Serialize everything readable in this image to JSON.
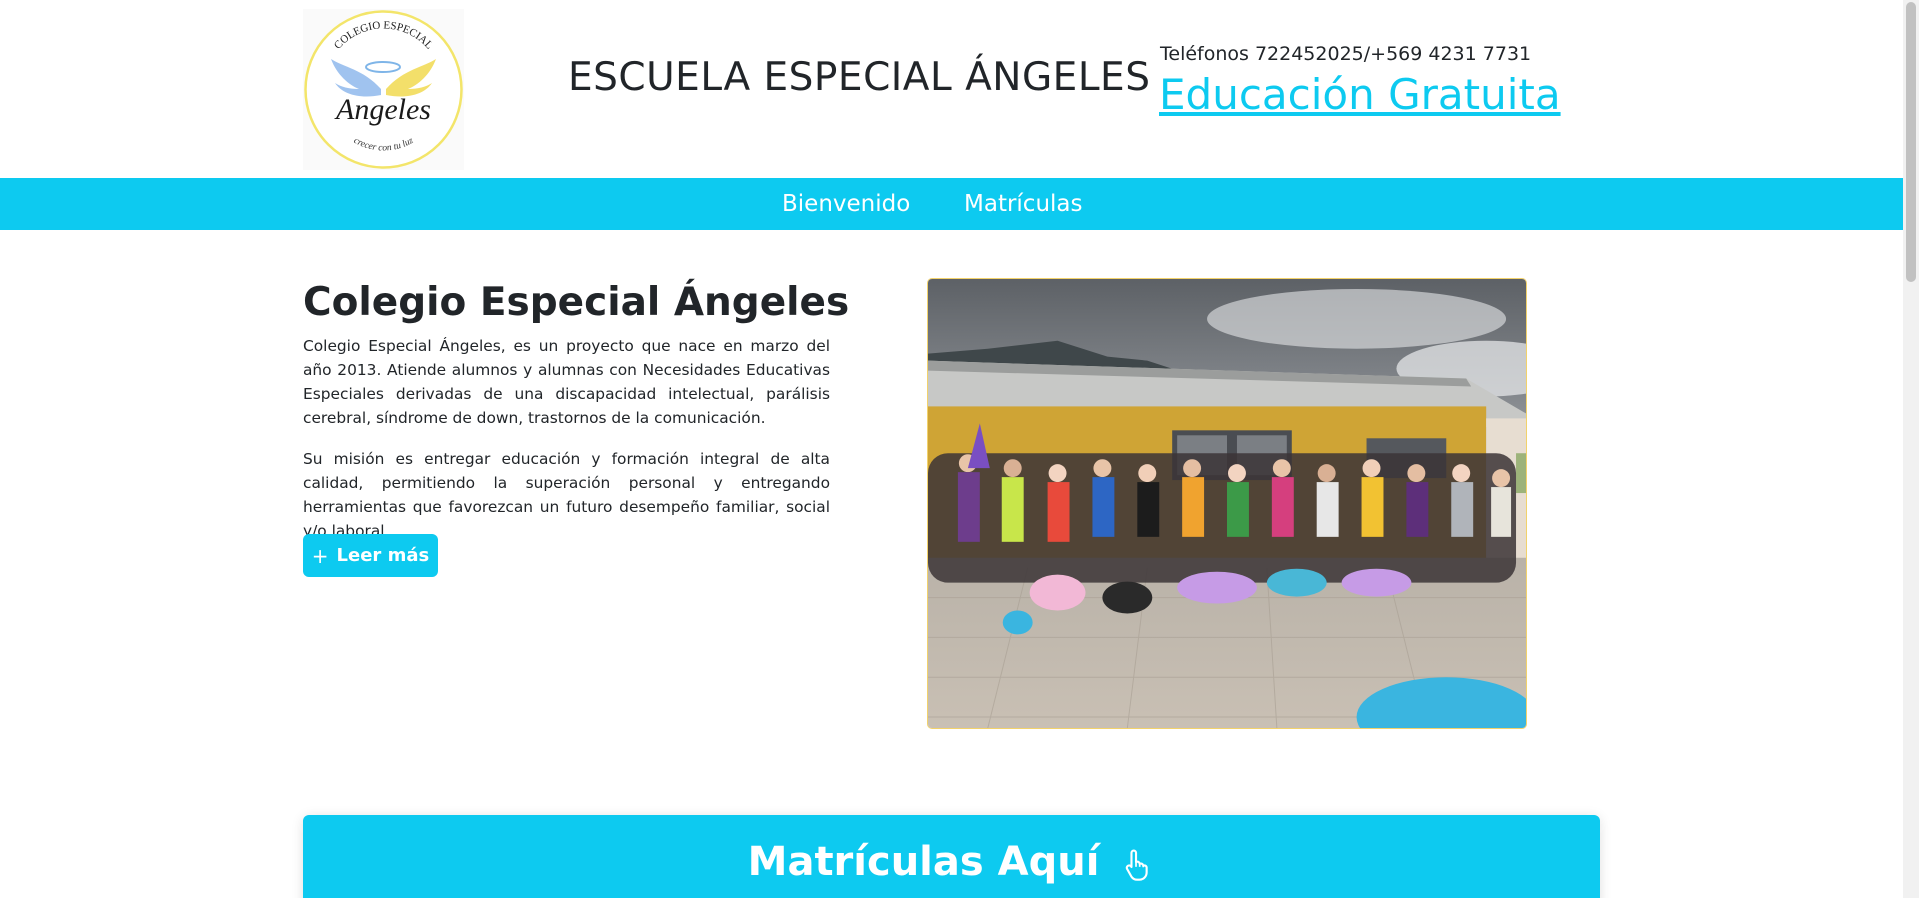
{
  "header": {
    "logo": {
      "icon": "angel-wings-logo-icon",
      "arc_text": "COLEGIO   ESPECIAL",
      "name": "Angeles",
      "motto": "crecer con tu luz"
    },
    "title": "ESCUELA ESPECIAL ÁNGELES",
    "phones": "Teléfonos 722452025/+569 4231 7731",
    "free_education": "Educación Gratuita"
  },
  "nav": {
    "items": [
      {
        "label": "Bienvenido"
      },
      {
        "label": "Matrículas"
      }
    ]
  },
  "intro": {
    "title": "Colegio Especial Ángeles",
    "paragraph1": "Colegio Especial Ángeles, es un proyecto que nace en marzo del año 2013. Atiende alumnos y alumnas con Necesidades Educativas Especiales derivadas de una discapacidad intelectual, parálisis cerebral, síndrome de down, trastornos de la comunicación.",
    "paragraph2": "Su misión es entregar educación y formación integral de alta calidad, permitiendo la superación personal y entregando herramientas que favorezcan un futuro desempeño familiar, social y/o laboral...",
    "read_more": "Leer más",
    "read_more_icon": "plus-icon"
  },
  "photo": {
    "subject": "group-photo"
  },
  "cta": {
    "label": "Matrículas Aquí",
    "icon": "hand-pointer-icon"
  },
  "colors": {
    "accent": "#0dcaf0",
    "text": "#212529",
    "photo_border": "#f2d26b"
  }
}
